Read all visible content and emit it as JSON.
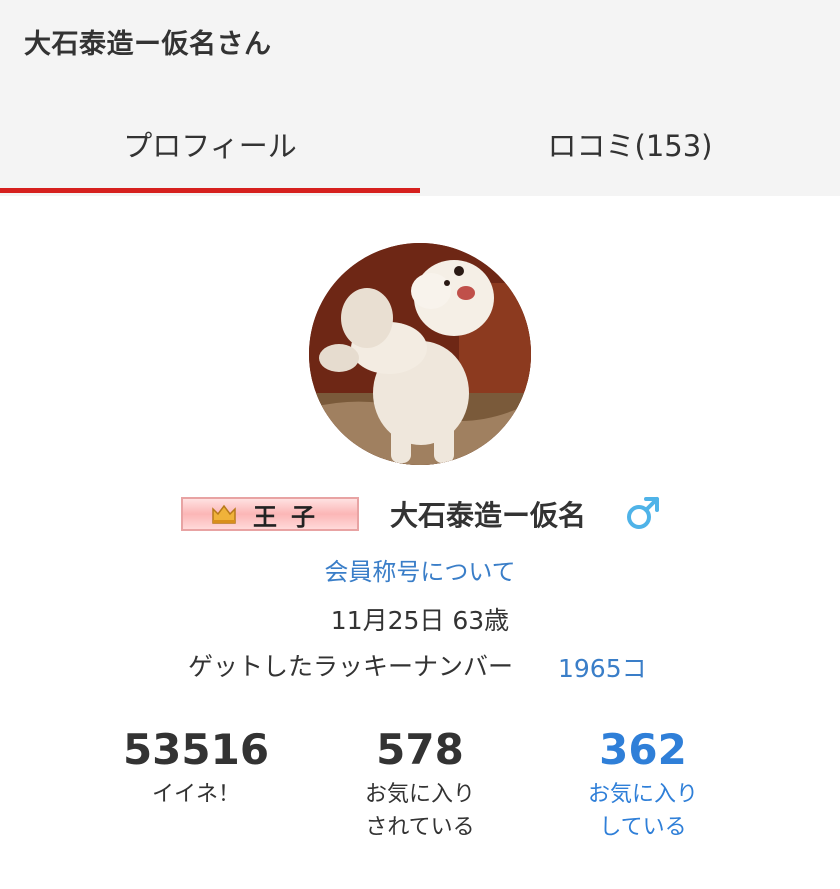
{
  "header": {
    "title": "大石泰造ー仮名さん"
  },
  "tabs": [
    {
      "label": "プロフィール",
      "active": true
    },
    {
      "label": "ロコミ(153)",
      "active": false
    }
  ],
  "colors": {
    "accent_red": "#d6201e",
    "link_blue": "#3a7ec8",
    "stat_blue": "#2f7fd8",
    "gender_blue": "#4fb3e8"
  },
  "profile": {
    "avatar_icon": "dog-photo-avatar",
    "rank_badge": "王子",
    "rank_icon": "crown-icon",
    "name": "大石泰造ー仮名",
    "gender_icon": "male-icon",
    "rank_link": "会員称号について",
    "birth_info": "11月25日 63歳",
    "lucky_number_label": "ゲットしたラッキーナンバー",
    "lucky_number_value": "1965コ"
  },
  "stats": {
    "likes": {
      "value": "53516",
      "label": "イイネ！"
    },
    "favorited_by": {
      "value": "578",
      "label_1": "お気に入り",
      "label_2": "されている"
    },
    "favoriting": {
      "value": "362",
      "label_1": "お気に入り",
      "label_2": "している"
    }
  }
}
